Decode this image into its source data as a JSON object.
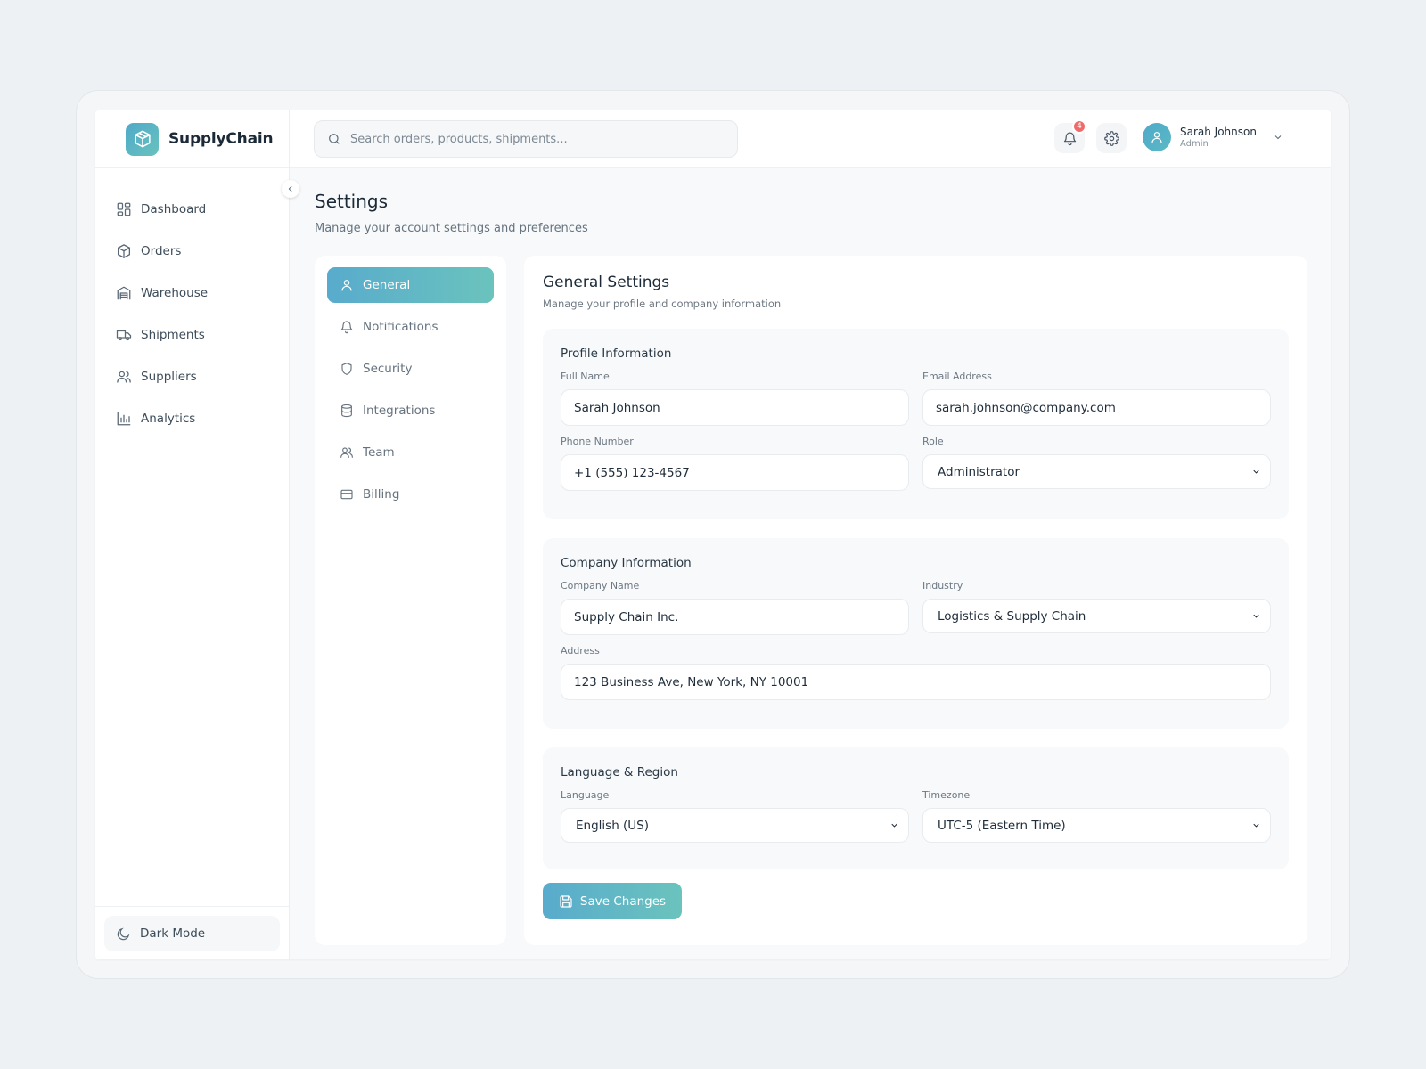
{
  "app": {
    "brand": "SupplyChain"
  },
  "sidebar": {
    "items": [
      {
        "label": "Dashboard",
        "icon": "dashboard-icon"
      },
      {
        "label": "Orders",
        "icon": "box-icon"
      },
      {
        "label": "Warehouse",
        "icon": "warehouse-icon"
      },
      {
        "label": "Shipments",
        "icon": "truck-icon"
      },
      {
        "label": "Suppliers",
        "icon": "users-icon"
      },
      {
        "label": "Analytics",
        "icon": "bar-chart-icon"
      }
    ],
    "dark_mode_label": "Dark Mode"
  },
  "topbar": {
    "search_placeholder": "Search orders, products, shipments...",
    "notification_count": "4",
    "user_name": "Sarah Johnson",
    "user_role": "Admin"
  },
  "header": {
    "title": "Settings",
    "subtitle": "Manage your account settings and preferences"
  },
  "settings_nav": {
    "items": [
      {
        "label": "General",
        "icon": "user-icon",
        "active": true
      },
      {
        "label": "Notifications",
        "icon": "bell-icon",
        "active": false
      },
      {
        "label": "Security",
        "icon": "shield-icon",
        "active": false
      },
      {
        "label": "Integrations",
        "icon": "database-icon",
        "active": false
      },
      {
        "label": "Team",
        "icon": "team-icon",
        "active": false
      },
      {
        "label": "Billing",
        "icon": "credit-card-icon",
        "active": false
      }
    ]
  },
  "general": {
    "title": "General Settings",
    "subtitle": "Manage your profile and company information",
    "profile": {
      "title": "Profile Information",
      "full_name_label": "Full Name",
      "full_name": "Sarah Johnson",
      "email_label": "Email Address",
      "email": "sarah.johnson@company.com",
      "phone_label": "Phone Number",
      "phone": "+1 (555) 123-4567",
      "role_label": "Role",
      "role": "Administrator"
    },
    "company": {
      "title": "Company Information",
      "name_label": "Company Name",
      "name": "Supply Chain Inc.",
      "industry_label": "Industry",
      "industry": "Logistics & Supply Chain",
      "address_label": "Address",
      "address": "123 Business Ave, New York, NY 10001"
    },
    "region": {
      "title": "Language & Region",
      "language_label": "Language",
      "language": "English (US)",
      "timezone_label": "Timezone",
      "timezone": "UTC-5 (Eastern Time)"
    },
    "save_label": "Save Changes"
  },
  "colors": {
    "accent_start": "#58abcc",
    "accent_end": "#6bc3bd",
    "badge": "#f06a6a"
  }
}
